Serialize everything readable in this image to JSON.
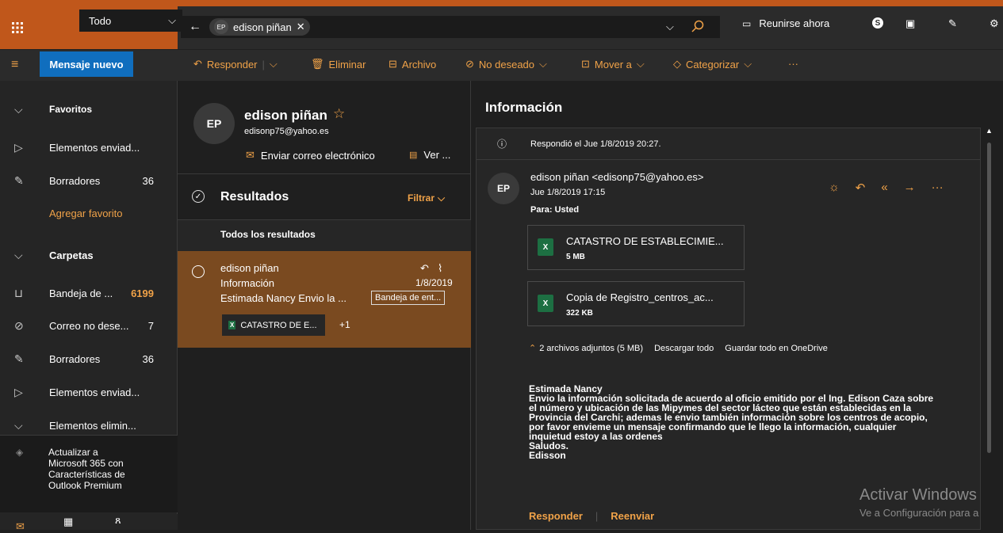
{
  "topbar": {
    "scope": "Todo",
    "search_chip_initials": "EP",
    "search_chip_name": "edison piñan",
    "meet_now": "Reunirse ahora"
  },
  "toolbar": {
    "new_message": "Mensaje nuevo",
    "reply": "Responder",
    "delete": "Eliminar",
    "archive": "Archivo",
    "junk": "No deseado",
    "move_to": "Mover a",
    "categorize": "Categorizar",
    "more": "···"
  },
  "sidebar": {
    "favorites": "Favoritos",
    "sent": "Elementos enviad...",
    "drafts": "Borradores",
    "drafts_count": "36",
    "add_favorite": "Agregar favorito",
    "folders": "Carpetas",
    "inbox": "Bandeja de ...",
    "inbox_count": "6199",
    "junk": "Correo no dese...",
    "junk_count": "7",
    "drafts2": "Borradores",
    "drafts2_count": "36",
    "sent2": "Elementos enviad...",
    "deleted": "Elementos elimin...",
    "upgrade": [
      "Actualizar a",
      "Microsoft 365 con",
      "Características de",
      "Outlook Premium"
    ]
  },
  "contact": {
    "initials": "EP",
    "name": "edison piñan",
    "email": "edisonp75@yahoo.es",
    "send_email": "Enviar correo electrónico",
    "view": "Ver ..."
  },
  "results": {
    "title": "Resultados",
    "filter": "Filtrar",
    "all_results": "Todos los resultados"
  },
  "message_item": {
    "sender": "edison piñan",
    "subject": "Información",
    "date": "1/8/2019",
    "preview": "Estimada Nancy Envio la ...",
    "folder_tag": "Bandeja de ent...",
    "attachment": "CATASTRO DE E...",
    "more_attachments": "+1"
  },
  "reading": {
    "subject": "Información",
    "replied_info": "Respondió el Jue 1/8/2019 20:27.",
    "sender_initials": "EP",
    "sender_line": "edison piñan <edisonp75@yahoo.es>",
    "sent_date": "Jue 1/8/2019 17:15",
    "to": "Para: Usted",
    "attachments": [
      {
        "name": "CATASTRO DE ESTABLECIMIE...",
        "size": "5 MB"
      },
      {
        "name": "Copia de Registro_centros_ac...",
        "size": "322 KB"
      }
    ],
    "attachments_summary": "2 archivos adjuntos (5 MB)",
    "download_all": "Descargar todo",
    "save_onedrive": "Guardar todo en OneDrive",
    "body": [
      "Estimada Nancy",
      "Envio la información solicitada de acuerdo al oficio emitido por el Ing. Edison Caza sobre",
      "el número y ubicación de las Mipymes del sector lácteo que están establecidas en la",
      "Provincia del Carchi; ademas le envio también información sobre los centros de acopio,",
      "por favor envieme un mensaje confirmando que le llego la información, cualquier",
      "inquietud estoy a las ordenes",
      "Saludos.",
      "Edisson"
    ],
    "reply": "Responder",
    "forward": "Reenviar"
  },
  "watermark": {
    "title": "Activar Windows",
    "subtitle": "Ve a Configuración para a"
  },
  "colors": {
    "accent": "#c0571b",
    "link_orange": "#f0a248",
    "primary_blue": "#106ebe",
    "selected_row": "#7a4a20"
  }
}
